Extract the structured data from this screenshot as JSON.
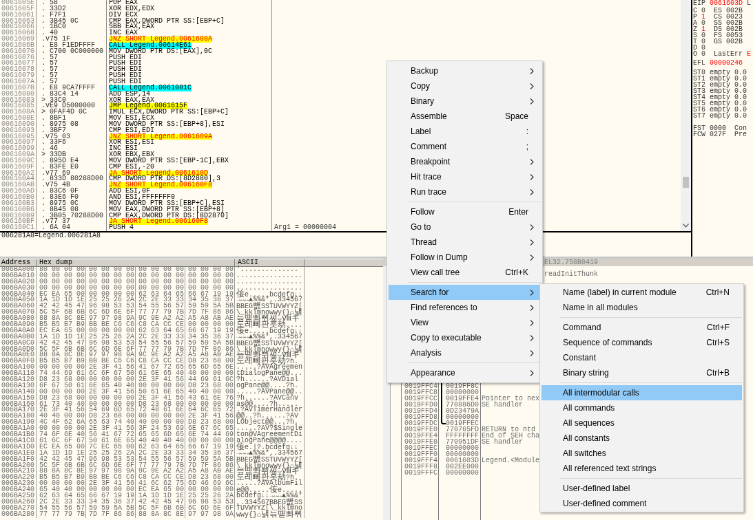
{
  "disassembly": {
    "rows": [
      {
        "address": "0061605E",
        "bytes": ". 58",
        "instruction": "POP EAX",
        "kind": "plain"
      },
      {
        "address": "0061605F",
        "bytes": ". 33D2",
        "instruction": "XOR EDX,EDX",
        "kind": "plain"
      },
      {
        "address": "00616061",
        "bytes": ". F7F1",
        "instruction": "DIV ECX",
        "kind": "plain"
      },
      {
        "address": "00616063",
        "bytes": ". 3B45 0C",
        "instruction": "CMP EAX,DWORD PTR SS:[EBP+C]",
        "kind": "plain"
      },
      {
        "address": "00616066",
        "bytes": ". 1BC0",
        "instruction": "SBB EAX,EAX",
        "kind": "plain"
      },
      {
        "address": "00616068",
        "bytes": ". 40",
        "instruction": "INC EAX",
        "kind": "plain"
      },
      {
        "address": "00616069",
        "bytes": ".v75 1F",
        "instruction": "JNZ SHORT Legend.0061608A",
        "kind": "jcc"
      },
      {
        "address": "0061606B",
        "bytes": ". E8 F1EDFFFF",
        "instruction": "CALL Legend.00614E61",
        "kind": "call"
      },
      {
        "address": "00616070",
        "bytes": ". C700 0C000000",
        "instruction": "MOV DWORD PTR DS:[EAX],0C",
        "kind": "plain"
      },
      {
        "address": "00616076",
        "bytes": ". 57",
        "instruction": "PUSH EDI",
        "kind": "plain"
      },
      {
        "address": "00616077",
        "bytes": ". 57",
        "instruction": "PUSH EDI",
        "kind": "plain"
      },
      {
        "address": "00616078",
        "bytes": ". 57",
        "instruction": "PUSH EDI",
        "kind": "plain"
      },
      {
        "address": "00616079",
        "bytes": ". 57",
        "instruction": "PUSH EDI",
        "kind": "plain"
      },
      {
        "address": "0061607A",
        "bytes": ". 57",
        "instruction": "PUSH EDI",
        "kind": "plain"
      },
      {
        "address": "0061607B",
        "bytes": ". E8 9CA7FFFF",
        "instruction": "CALL Legend.0061081C",
        "kind": "call"
      },
      {
        "address": "00616080",
        "bytes": ". 83C4 14",
        "instruction": "ADD ESP,14",
        "kind": "plain"
      },
      {
        "address": "00616083",
        "bytes": "> 33C0",
        "instruction": "XOR EAX,EAX",
        "kind": "plain"
      },
      {
        "address": "00616085",
        "bytes": ".vE9 D5000000",
        "instruction": "JMP Legend.0061615F",
        "kind": "jmp"
      },
      {
        "address": "0061608A",
        "bytes": "> 0FAF4D 0C",
        "instruction": "IMUL ECX,DWORD PTR SS:[EBP+C]",
        "kind": "plain"
      },
      {
        "address": "0061608E",
        "bytes": ". 8BF1",
        "instruction": "MOV ESI,ECX",
        "kind": "plain"
      },
      {
        "address": "00616090",
        "bytes": ". 8975 08",
        "instruction": "MOV DWORD PTR SS:[EBP+8],ESI",
        "kind": "plain"
      },
      {
        "address": "00616093",
        "bytes": ". 3BF7",
        "instruction": "CMP ESI,EDI",
        "kind": "plain"
      },
      {
        "address": "00616095",
        "bytes": ".v75 03",
        "instruction": "JNZ SHORT Legend.0061609A",
        "kind": "jcc"
      },
      {
        "address": "00616097",
        "bytes": ". 33F6",
        "instruction": "XOR ESI,ESI",
        "kind": "plain"
      },
      {
        "address": "00616099",
        "bytes": ". 46",
        "instruction": "INC ESI",
        "kind": "plain"
      },
      {
        "address": "0061609A",
        "bytes": "> 33DB",
        "instruction": "XOR EBX,EBX",
        "kind": "plain"
      },
      {
        "address": "0061609C",
        "bytes": ". 895D E4",
        "instruction": "MOV DWORD PTR SS:[EBP-1C],EBX",
        "kind": "plain"
      },
      {
        "address": "0061609F",
        "bytes": ". 83FE E0",
        "instruction": "CMP ESI,-20",
        "kind": "plain"
      },
      {
        "address": "006160A2",
        "bytes": ".v77 69",
        "instruction": "JA SHORT Legend.0061610D",
        "kind": "jcc"
      },
      {
        "address": "006160A4",
        "bytes": ". 833D 80288D00",
        "instruction": "CMP DWORD PTR DS:[8D2880],3",
        "kind": "plain"
      },
      {
        "address": "006160AB",
        "bytes": ".v75 4B",
        "instruction": "JNZ SHORT Legend.006160F8",
        "kind": "jcc"
      },
      {
        "address": "006160AD",
        "bytes": ". 83C6 0F",
        "instruction": "ADD ESI,0F",
        "kind": "plain"
      },
      {
        "address": "006160B0",
        "bytes": ". 83E6 F0",
        "instruction": "AND ESI,FFFFFFF0",
        "kind": "plain"
      },
      {
        "address": "006160B3",
        "bytes": ". 8975 0C",
        "instruction": "MOV DWORD PTR SS:[EBP+C],ESI",
        "kind": "plain"
      },
      {
        "address": "006160B6",
        "bytes": ". 8B45 08",
        "instruction": "MOV EAX,DWORD PTR SS:[EBP+8]",
        "kind": "plain"
      },
      {
        "address": "006160B9",
        "bytes": ". 3B05 70288D00",
        "instruction": "CMP EAX,DWORD PTR DS:[8D2870]",
        "kind": "plain"
      },
      {
        "address": "006160BF",
        "bytes": ".v77 37",
        "instruction": "JA SHORT Legend.006160F8",
        "kind": "jcc"
      },
      {
        "address": "006160C1",
        "bytes": ". 6A 04",
        "instruction": "PUSH 4",
        "kind": "plain",
        "comment": "Arg1 = 00000004"
      }
    ]
  },
  "info_line": "006281A8=Legend.006281A8",
  "registers": {
    "eip": {
      "name": "EIP",
      "value": "0061603D",
      "changed": true,
      "note": "L"
    },
    "flags": [
      {
        "flag": "C",
        "value": "0",
        "changed": false,
        "segment": "ES 002B"
      },
      {
        "flag": "P",
        "value": "1",
        "changed": true,
        "segment": "CS 0023"
      },
      {
        "flag": "A",
        "value": "0",
        "changed": false,
        "segment": "SS 002B"
      },
      {
        "flag": "Z",
        "value": "1",
        "changed": true,
        "segment": "DS 002B"
      },
      {
        "flag": "S",
        "value": "0",
        "changed": false,
        "segment": "FS 0053"
      },
      {
        "flag": "T",
        "value": "0",
        "changed": false,
        "segment": "GS 002B"
      },
      {
        "flag": "D",
        "value": "0",
        "changed": false
      },
      {
        "flag": "O",
        "value": "0",
        "changed": false,
        "last_error": {
          "label": "LastErr",
          "value": "E",
          "changed": true
        }
      }
    ],
    "efl": {
      "name": "EFL",
      "value": "00000246",
      "changed": true
    },
    "fpu": [
      "ST0 empty 0.0",
      "ST1 empty 0.0",
      "ST2 empty 0.0",
      "ST3 empty 0.0",
      "ST4 empty 0.0",
      "ST5 empty 0.0",
      "ST6 empty 0.0",
      "ST7 empty 0.0"
    ],
    "fpu_control": [
      {
        "name": "FST",
        "value": "0000",
        "note": "Con"
      },
      {
        "name": "FCW",
        "value": "027F",
        "note": "Pre"
      }
    ]
  },
  "dump": {
    "columns": [
      "Address",
      "Hex dump",
      "ASCII"
    ],
    "rows": [
      {
        "address": "006BA000",
        "hex": [
          "80 00 00 00",
          "00 00 00 00",
          "00 00 00 00",
          "00 00 00 00"
        ],
        "ascii": "'.............."
      },
      {
        "address": "006BA010",
        "hex": [
          "00 00 00 00",
          "00 00 00 00",
          "00 00 00 00",
          "00 00 00 00"
        ],
        "ascii": "................"
      },
      {
        "address": "006BA020",
        "hex": [
          "00 00 00 00",
          "00 00 00 00",
          "00 00 00 00",
          "00 00 00 00"
        ],
        "ascii": "................"
      },
      {
        "address": "006BA030",
        "hex": [
          "00 00 00 00",
          "00 00 00 00",
          "00 00 00 00",
          "00 00 00 00"
        ],
        "ascii": "................"
      },
      {
        "address": "006BA040",
        "hex": [
          "EC EA 65 00",
          "00 00 00 00",
          "62 63 64 65",
          "66 67 19 19"
        ],
        "ascii": "侫e.....bcdefg↓↓"
      },
      {
        "address": "006BA050",
        "hex": [
          "1A 1D 1D 1E",
          "25 25 26 2A",
          "2C 2E 33 33",
          "34 35 36 37"
        ],
        "ascii": "→↔↔▲%%&*,.334567"
      },
      {
        "address": "006BA060",
        "hex": [
          "42 42 45 47",
          "96 98 53 53",
          "54 55 56 57",
          "59 59 5A 5B"
        ],
        "ascii": "BBEG뺎SSTUVWYYZ["
      },
      {
        "address": "006BA070",
        "hex": [
          "5C 5F 6B 6B",
          "6C 6D 6E 6F",
          "77 77 79 7B",
          "7D 7F 86 86"
        ],
        "ascii": "\\_kklmnowwy{}⌂낽"
      },
      {
        "address": "006BA080",
        "hex": [
          "88 8A 8C 8E",
          "97 97 98 9A",
          "9C 9E A2 A2",
          "A5 A8 AB AE"
        ],
        "ascii": "늒뗻뽜쀠쎠⇔ⅷギ"
      },
      {
        "address": "006BA090",
        "hex": [
          "B5 B5 B7 B9",
          "BB BE C6 C6",
          "C8 CA CC CE",
          "00 00 00 00"
        ],
        "ascii": "도레뻬판훗劫...."
      },
      {
        "address": "006BA0A0",
        "hex": [
          "EC EA 65 00",
          "00 00 00 00",
          "62 63 64 65",
          "66 67 19 19"
        ],
        "ascii": "侫e.....bcdefg↓↓"
      },
      {
        "address": "006BA0B0",
        "hex": [
          "1A 1D 1D 1E",
          "25 25 26 2A",
          "2C 2E 33 33",
          "34 35 36 37"
        ],
        "ascii": "→↔↔▲%%&*,.334567"
      },
      {
        "address": "006BA0C0",
        "hex": [
          "42 42 45 47",
          "96 98 53 53",
          "54 55 56 57",
          "59 59 5A 5B"
        ],
        "ascii": "BBEG뺎SSTUVWYYZ["
      },
      {
        "address": "006BA0D0",
        "hex": [
          "5C 5F 6B 6B",
          "6C 6D 6E 6F",
          "77 77 79 7B",
          "7D 7F 86 86"
        ],
        "ascii": "\\_kklmnowwy{}⌂낽"
      },
      {
        "address": "006BA0E0",
        "hex": [
          "88 8A 8C 8E",
          "97 97 98 9A",
          "9C 9E A2 A2",
          "A5 A8 AB AE"
        ],
        "ascii": "늒뗻뽜쀠쎠⇔ⅷギ"
      },
      {
        "address": "006BA0F0",
        "hex": [
          "B5 B5 B7 B9",
          "BB BE C6 C6",
          "C8 CA CC CE",
          "D8 23 68 00"
        ],
        "ascii": "도레뻬판훗劫?h."
      },
      {
        "address": "006BA100",
        "hex": [
          "00 00 00 00",
          "2E 3F 41 56",
          "41 67 72 65",
          "65 6D 65 6E"
        ],
        "ascii": ".....?AVAgreemen"
      },
      {
        "address": "006BA110",
        "hex": [
          "74 44 69 61",
          "6C 6F 67 50",
          "61 6E 65 40",
          "40 00 00 00"
        ],
        "ascii": "tDialogPane@@..."
      },
      {
        "address": "006BA120",
        "hex": [
          "D8 23 68 00",
          "00 00 00 00",
          "2E 3F 41 56",
          "44 69 61 6C"
        ],
        "ascii": "?h......?AVDial"
      },
      {
        "address": "006BA130",
        "hex": [
          "6F 67 50 61",
          "6E 65 40 40",
          "00 00 00 00",
          "D8 23 68 00"
        ],
        "ascii": "ogPane@@....?h."
      },
      {
        "address": "006BA140",
        "hex": [
          "00 00 00 00",
          "2E 3F 41 56",
          "50 61 6E 65",
          "40 40 00 00"
        ],
        "ascii": ".....?AVPane@@.."
      },
      {
        "address": "006BA150",
        "hex": [
          "D8 23 68 00",
          "00 00 00 00",
          "2E 3F 41 56",
          "43 61 6E 76"
        ],
        "ascii": "?h......?AVCanv"
      },
      {
        "address": "006BA160",
        "hex": [
          "61 73 40 40",
          "00 00 00 00",
          "D8 23 68 00",
          "00 00 00 00"
        ],
        "ascii": "as@@....?h....."
      },
      {
        "address": "006BA170",
        "hex": [
          "2E 3F 41 56",
          "54 69 6D 65",
          "72 48 61 6E",
          "64 6C 65 72"
        ],
        "ascii": ".?AVTimerHandler"
      },
      {
        "address": "006BA180",
        "hex": [
          "40 40 00 00",
          "D8 23 68 00",
          "00 00 00 00",
          "2E 3F 41 56"
        ],
        "ascii": "@@..?h......?AV"
      },
      {
        "address": "006BA190",
        "hex": [
          "4C 4F 62 6A",
          "65 63 74 40",
          "40 00 00 00",
          "D8 23 68 00"
        ],
        "ascii": "LObject@@...?h."
      },
      {
        "address": "006BA1A0",
        "hex": [
          "00 00 00 00",
          "2E 3F 41 56",
          "3F 24 53 69",
          "6E 67 6C 65"
        ],
        "ascii": ".....?AV?$Single"
      },
      {
        "address": "006BA1B0",
        "hex": [
          "74 6F 6E 40",
          "56 41 67 72",
          "65 65 6D 65",
          "6E 74 44 69"
        ],
        "ascii": "ton@VAgreementDi"
      },
      {
        "address": "006BA1C0",
        "hex": [
          "61 6C 6F 67",
          "50 61 6E 65",
          "40 40 40 40",
          "00 00 00 00"
        ],
        "ascii": "alogPane@@@@...."
      },
      {
        "address": "006BA1D0",
        "hex": [
          "EC EA 65 00",
          "7C EC 65 00",
          "62 63 64 65",
          "66 67 19 19"
        ],
        "ascii": "侫e.|?.bcdefg↓↓"
      },
      {
        "address": "006BA1E0",
        "hex": [
          "1A 1D 1D 1E",
          "25 25 26 2A",
          "2C 2E 33 33",
          "34 35 36 37"
        ],
        "ascii": "→↔↔▲%%&*,.334567"
      },
      {
        "address": "006BA1F0",
        "hex": [
          "42 42 45 47",
          "96 98 53 53",
          "54 55 56 57",
          "59 59 5A 5B"
        ],
        "ascii": "BBEG뺎SSTUVWYYZ["
      },
      {
        "address": "006BA200",
        "hex": [
          "5C 5F 6B 6B",
          "6C 6D 6E 6F",
          "77 77 79 7B",
          "7D 7F 86 86"
        ],
        "ascii": "\\_kklmnowwy{}⌂낽"
      },
      {
        "address": "006BA210",
        "hex": [
          "88 8A 8C 8E",
          "97 97 98 9A",
          "9C 9E A2 A2",
          "A5 A8 AB AE"
        ],
        "ascii": "늒뗻뽜쀠쎠⇔ⅷギ"
      },
      {
        "address": "006BA220",
        "hex": [
          "B5 B5 B7 B9",
          "BB BE C6 C6",
          "C8 CA CC CE",
          "D8 23 68 00"
        ],
        "ascii": "도레뻬판훗劫?h."
      },
      {
        "address": "006BA230",
        "hex": [
          "00 00 00 00",
          "2E 3F 41 56",
          "41 6C 62 75",
          "6D 46 69 6C"
        ],
        "ascii": ".....?AVAlbumFil"
      },
      {
        "address": "006BA240",
        "hex": [
          "65 40 40 00",
          "00 00 00 00",
          "EC EA 65 00",
          "00 00 00 00"
        ],
        "ascii": "e@@.....侫e....."
      },
      {
        "address": "006BA250",
        "hex": [
          "62 63 64 65",
          "66 67 19 19",
          "1A 1D 1D 1E",
          "25 25 26 2A"
        ],
        "ascii": "bcdefg↓↓→↔↔▲%%&*"
      },
      {
        "address": "006BA260",
        "hex": [
          "2C 2E 33 33",
          "34 35 36 37",
          "42 42 45 47",
          "96 98 53 53"
        ],
        "ascii": ",.334567BBEG뺎SS"
      },
      {
        "address": "006BA270",
        "hex": [
          "54 55 56 57",
          "59 59 5A 5B",
          "5C 5F 6B 6B",
          "6C 6D 6E 6F"
        ],
        "ascii": "TUVWYYZ[\\_kklmno"
      },
      {
        "address": "006BA280",
        "hex": [
          "77 77 79 7B",
          "7D 7F 86 86",
          "88 8A 8C 8E",
          "97 97 98 9A"
        ],
        "ascii": "wwy{}⌂낽늒뗻뽜쀠"
      }
    ]
  },
  "stack": {
    "info": "EL32.758B0419",
    "top_comment": "readInitThunk",
    "rows": [
      {
        "address": "0019FFC4",
        "value": "0019FF8C",
        "chain": true
      },
      {
        "address": "0019FFC8",
        "value": "00000000",
        "chain": true
      },
      {
        "address": "0019FFCC",
        "value": "0019FFE4",
        "comment": "Pointer to nex",
        "chain": true
      },
      {
        "address": "0019FFD0",
        "value": "770886D0",
        "comment": "SE handler",
        "chain": true
      },
      {
        "address": "0019FFD4",
        "value": "0D23479A",
        "chain": true
      },
      {
        "address": "0019FFD8",
        "value": "00000000",
        "chain": true
      },
      {
        "address": "0019FFDC",
        "value": "0019FFEC",
        "chain": true
      },
      {
        "address": "0019FFE0",
        "value": "770765FD",
        "comment": "RETURN to ntd",
        "chain": false
      },
      {
        "address": "0019FFE4",
        "value": "FFFFFFFF",
        "comment": "End of SEH cha",
        "chain": false
      },
      {
        "address": "0019FFE8",
        "value": "770951DF",
        "comment": "SE handler",
        "chain": false
      },
      {
        "address": "0019FFEC",
        "value": "00000000",
        "chain": false
      },
      {
        "address": "0019FFF0",
        "value": "00000000",
        "chain": false
      },
      {
        "address": "0019FFF4",
        "value": "0061603D",
        "comment": "Legend.<Module",
        "chain": false
      },
      {
        "address": "0019FFF8",
        "value": "002EE000",
        "chain": false
      },
      {
        "address": "0019FFFC",
        "value": "00000000",
        "chain": false
      }
    ]
  },
  "context_menu": {
    "groups": [
      {
        "items": [
          {
            "label": "Backup",
            "submenu": true,
            "selected": false
          },
          {
            "label": "Copy",
            "submenu": true,
            "selected": false
          },
          {
            "label": "Binary",
            "submenu": true,
            "selected": false
          },
          {
            "label": "Assemble",
            "shortcut": "Space",
            "submenu": false,
            "selected": false
          },
          {
            "label": "Label",
            "shortcut": ":",
            "submenu": false,
            "selected": false
          },
          {
            "label": "Comment",
            "shortcut": ";",
            "submenu": false,
            "selected": false
          },
          {
            "label": "Breakpoint",
            "submenu": true,
            "selected": false
          },
          {
            "label": "Hit trace",
            "submenu": true,
            "selected": false
          },
          {
            "label": "Run trace",
            "submenu": true,
            "selected": false
          }
        ]
      },
      {
        "items": [
          {
            "label": "Follow",
            "shortcut": "Enter",
            "submenu": false,
            "selected": false
          },
          {
            "label": "Go to",
            "submenu": true,
            "selected": false
          },
          {
            "label": "Thread",
            "submenu": true,
            "selected": false
          },
          {
            "label": "Follow in Dump",
            "submenu": true,
            "selected": false
          },
          {
            "label": "View call tree",
            "shortcut": "Ctrl+K",
            "submenu": false,
            "selected": false
          }
        ]
      },
      {
        "items": [
          {
            "label": "Search for",
            "submenu": true,
            "selected": true
          },
          {
            "label": "Find references to",
            "submenu": true,
            "selected": false
          },
          {
            "label": "View",
            "submenu": true,
            "selected": false
          },
          {
            "label": "Copy to executable",
            "submenu": true,
            "selected": false
          },
          {
            "label": "Analysis",
            "submenu": true,
            "selected": false
          }
        ]
      },
      {
        "items": [
          {
            "label": "Appearance",
            "submenu": true,
            "selected": false
          }
        ]
      }
    ]
  },
  "submenu": {
    "groups": [
      {
        "items": [
          {
            "label": "Name (label) in current module",
            "shortcut": "Ctrl+N",
            "selected": false
          },
          {
            "label": "Name in all modules",
            "selected": false
          }
        ]
      },
      {
        "items": [
          {
            "label": "Command",
            "shortcut": "Ctrl+F",
            "selected": false
          },
          {
            "label": "Sequence of commands",
            "shortcut": "Ctrl+S",
            "selected": false
          },
          {
            "label": "Constant",
            "selected": false
          },
          {
            "label": "Binary string",
            "shortcut": "Ctrl+B",
            "selected": false
          }
        ]
      },
      {
        "items": [
          {
            "label": "All intermodular calls",
            "selected": true
          },
          {
            "label": "All commands",
            "selected": false
          },
          {
            "label": "All sequences",
            "selected": false
          },
          {
            "label": "All constants",
            "selected": false
          },
          {
            "label": "All switches",
            "selected": false
          },
          {
            "label": "All referenced text strings",
            "selected": false
          }
        ]
      },
      {
        "items": [
          {
            "label": "User-defined label",
            "selected": false
          },
          {
            "label": "User-defined comment",
            "selected": false
          }
        ]
      }
    ]
  }
}
